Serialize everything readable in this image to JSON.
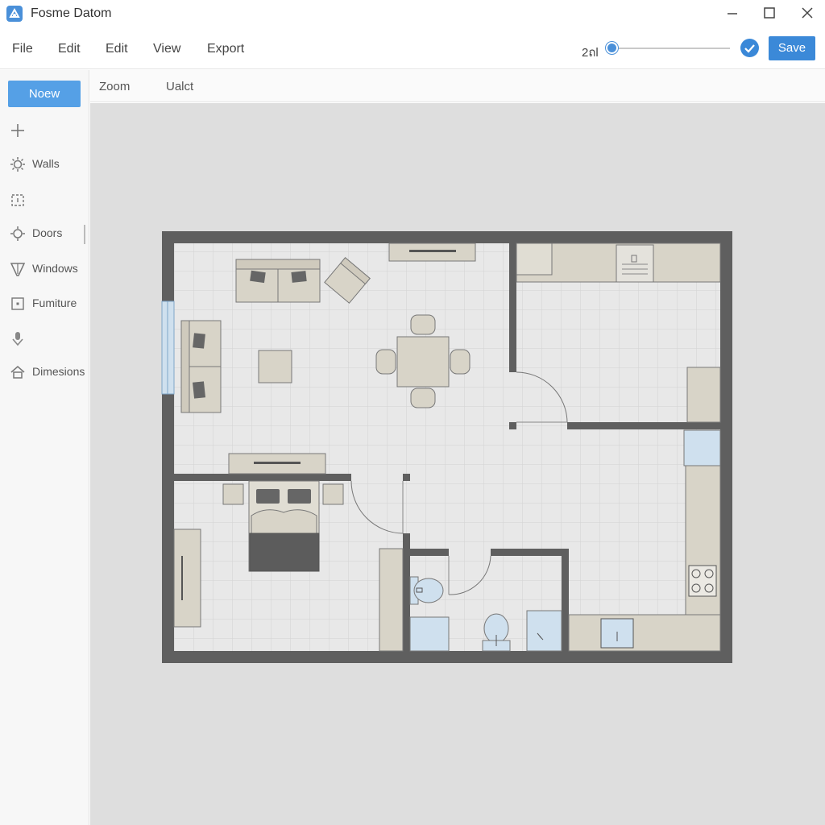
{
  "app": {
    "title": "Fosme Datom"
  },
  "menu": {
    "items": [
      "File",
      "Edit",
      "Edit",
      "View",
      "Export"
    ]
  },
  "toolbar": {
    "zoom_value": "2ถl",
    "zoom_level": 0.0,
    "save_label": "Save",
    "accent": "#3b89d8"
  },
  "sidebar": {
    "new_label": "Noew",
    "tools": [
      {
        "label": "",
        "icon": "plus-icon"
      },
      {
        "label": "Walls",
        "icon": "walls-icon"
      },
      {
        "label": "",
        "icon": "select-icon"
      },
      {
        "label": "Doors",
        "icon": "doors-icon"
      },
      {
        "label": "Windows",
        "icon": "windows-icon"
      },
      {
        "label": "Fumiture",
        "icon": "furniture-icon"
      },
      {
        "label": "",
        "icon": "pin-icon"
      },
      {
        "label": "Dimesions",
        "icon": "dimensions-icon"
      }
    ]
  },
  "subbar": {
    "items": [
      "Zoom",
      "Ualct"
    ]
  },
  "colors": {
    "wall": "#5f5f5f",
    "floor": "#e8e8e8",
    "furniture": "#d8d4c8",
    "fixture_blue": "#cfe0ee",
    "canvas": "#dedede"
  }
}
